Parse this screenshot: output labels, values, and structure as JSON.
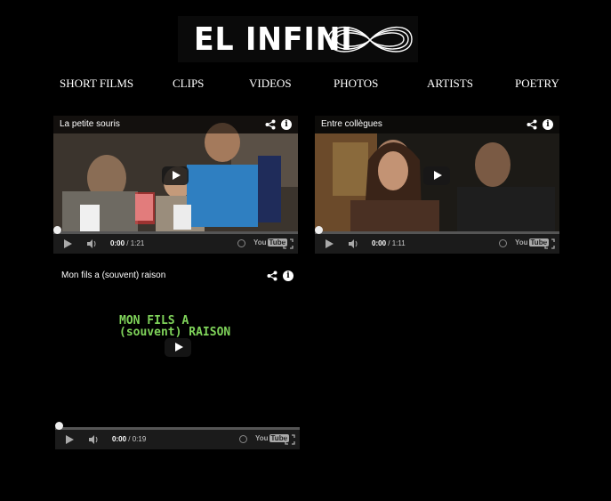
{
  "header": {
    "logo_text": "EL INFINI",
    "logo_icon": "infinity-scribble-logo"
  },
  "nav": {
    "items": [
      "SHORT FILMS",
      "CLIPS",
      "VIDEOS",
      "PHOTOS",
      "ARTISTS",
      "POETRY"
    ]
  },
  "videos": [
    {
      "title": "La petite souris",
      "time_current": "0:00",
      "time_total": "/ 1:21",
      "progress": 0
    },
    {
      "title": "Entre collègues",
      "time_current": "0:00",
      "time_total": "/ 1:11",
      "progress": 0
    },
    {
      "title": "Mon fils a (souvent) raison",
      "time_current": "0:00",
      "time_total": "/ 0:19",
      "progress": 0,
      "title_card": [
        "MON FILS A",
        "(souvent) RAISON"
      ]
    }
  ],
  "player": {
    "youtube_label": "You",
    "youtube_tube": "Tube"
  },
  "colors": {
    "background": "#000000",
    "title_card_green": "#7fd35a",
    "controls_bg": "#1b1b1b"
  }
}
